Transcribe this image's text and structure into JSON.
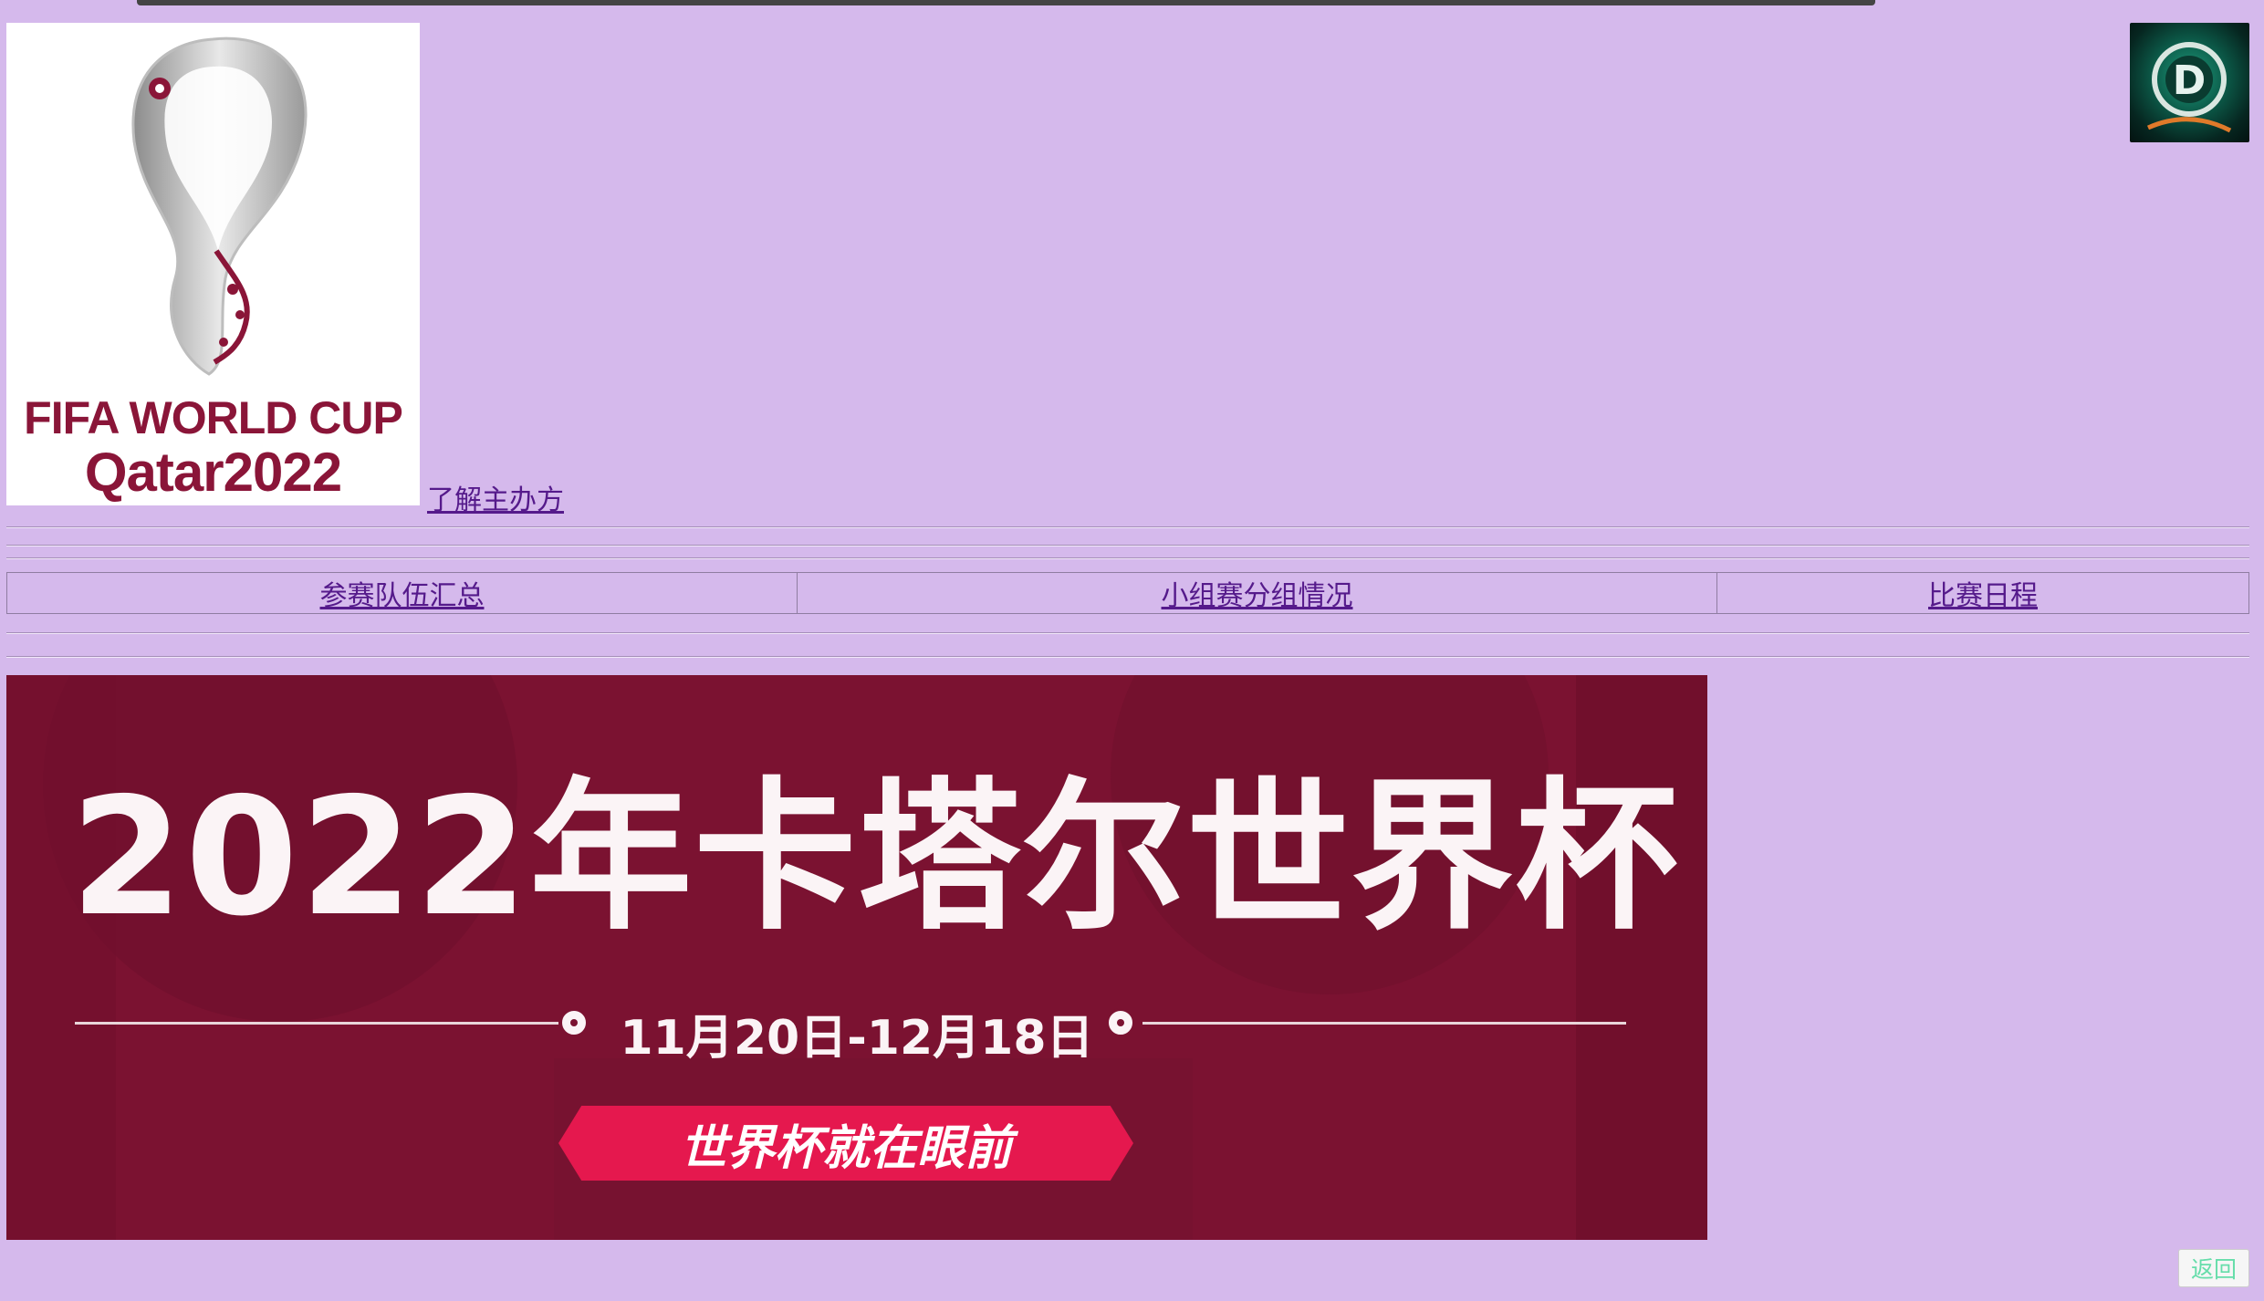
{
  "header": {
    "logo_line1": "FIFA WORLD CUP",
    "logo_line2": "Qatar2022",
    "host_link": "了解主办方"
  },
  "nav": {
    "items": [
      {
        "label": "参赛队伍汇总"
      },
      {
        "label": "小组赛分组情况"
      },
      {
        "label": "比赛日程"
      }
    ]
  },
  "banner": {
    "title": "2022年卡塔尔世界杯",
    "dates": "11月20日-12月18日",
    "slogan": "世界杯就在眼前"
  },
  "footer": {
    "back_label": "返回"
  },
  "colors": {
    "page_background": "#d5b9ec",
    "link": "#551a8b",
    "banner_background": "#7b1231",
    "slogan_ribbon": "#e5184e",
    "back_text": "#66ddaa"
  },
  "icons": {
    "logo": "fifa-world-cup-qatar-2022-emblem",
    "badge": "app-badge-icon"
  }
}
